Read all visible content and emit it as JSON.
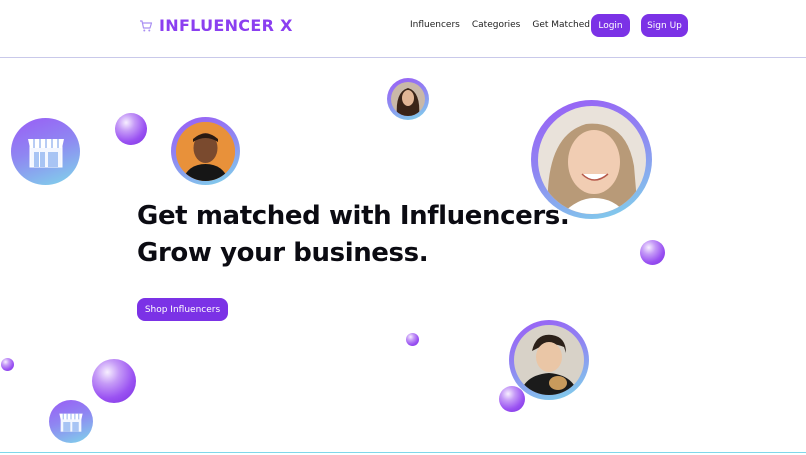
{
  "brand": {
    "name": "INFLUENCER X",
    "icon": "shopping-cart-icon"
  },
  "nav": {
    "items": [
      "Influencers",
      "Categories",
      "Get Matched"
    ],
    "login_label": "Login",
    "signup_label": "Sign Up"
  },
  "hero": {
    "headline_line1": "Get matched with Influencers.",
    "headline_line2": "Grow your business.",
    "cta_label": "Shop Influencers"
  },
  "colors": {
    "accent": "#7b32e6",
    "brand_text": "#8b3ff0",
    "ring_start": "#9a5cf6",
    "ring_end": "#7fd7ea"
  },
  "decor": {
    "store_icon": "storefront-icon",
    "avatars": [
      "influencer-avatar-1",
      "influencer-avatar-2",
      "influencer-avatar-3",
      "influencer-avatar-4"
    ]
  }
}
